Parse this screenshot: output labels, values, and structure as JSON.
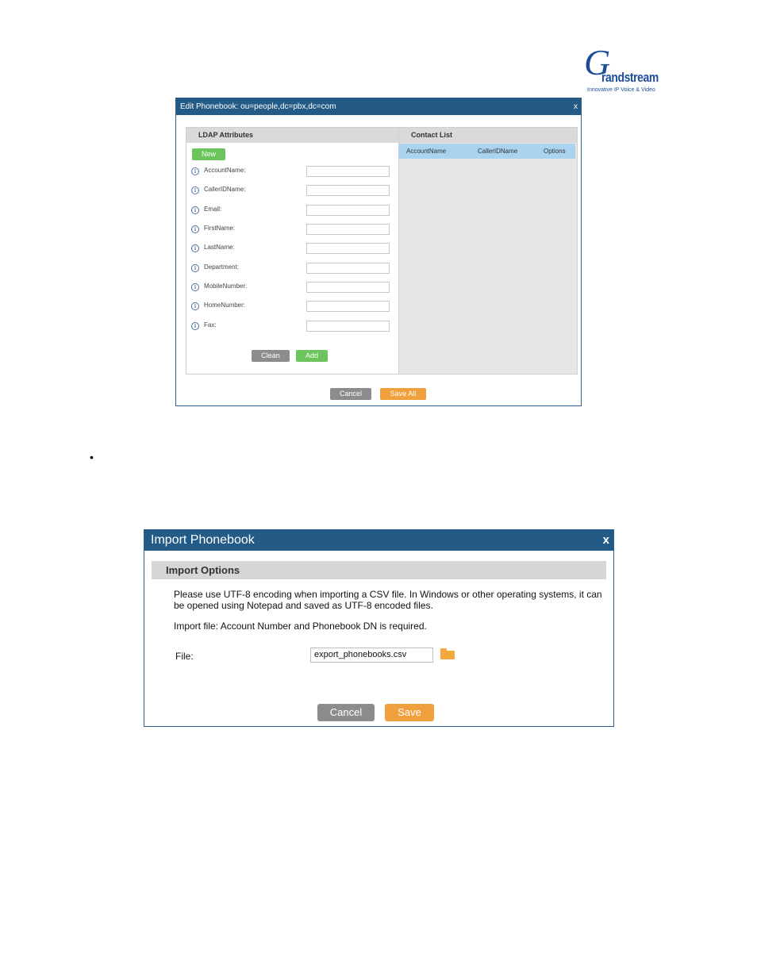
{
  "logo": {
    "initial": "G",
    "word": "randstream",
    "tagline": "Innovative IP Voice & Video"
  },
  "edit_dialog": {
    "title": "Edit Phonebook: ou=people,dc=pbx,dc=com",
    "close": "x",
    "ldap_header": "LDAP Attributes",
    "new_label": "New",
    "info_glyph": "i",
    "attributes": [
      {
        "label": "AccountName:",
        "value": ""
      },
      {
        "label": "CallerIDName:",
        "value": ""
      },
      {
        "label": "Email:",
        "value": ""
      },
      {
        "label": "FirstName:",
        "value": ""
      },
      {
        "label": "LastName:",
        "value": ""
      },
      {
        "label": "Department:",
        "value": ""
      },
      {
        "label": "MobileNumber:",
        "value": ""
      },
      {
        "label": "HomeNumber:",
        "value": ""
      },
      {
        "label": "Fax:",
        "value": ""
      }
    ],
    "clean_label": "Clean",
    "add_label": "Add",
    "contact_header": "Contact List",
    "columns": [
      "AccountName",
      "CallerIDName",
      "Options"
    ],
    "cancel_label": "Cancel",
    "save_all_label": "Save All"
  },
  "bullet": "•",
  "import_dialog": {
    "title": "Import Phonebook",
    "close": "x",
    "options_header": "Import Options",
    "note": "Please use UTF-8 encoding when importing a CSV file. In Windows or other operating systems, it can be opened using Notepad and saved as UTF-8 encoded files.",
    "requirement": "Import file: Account Number and Phonebook DN is required.",
    "file_label": "File:",
    "file_value": "export_phonebooks.csv",
    "cancel_label": "Cancel",
    "save_label": "Save"
  },
  "colors": {
    "titlebar": "#235b86",
    "green": "#6cc55c",
    "orange": "#f0a03c",
    "gray_button": "#8c8c8c",
    "table_header": "#a9d3ef"
  }
}
